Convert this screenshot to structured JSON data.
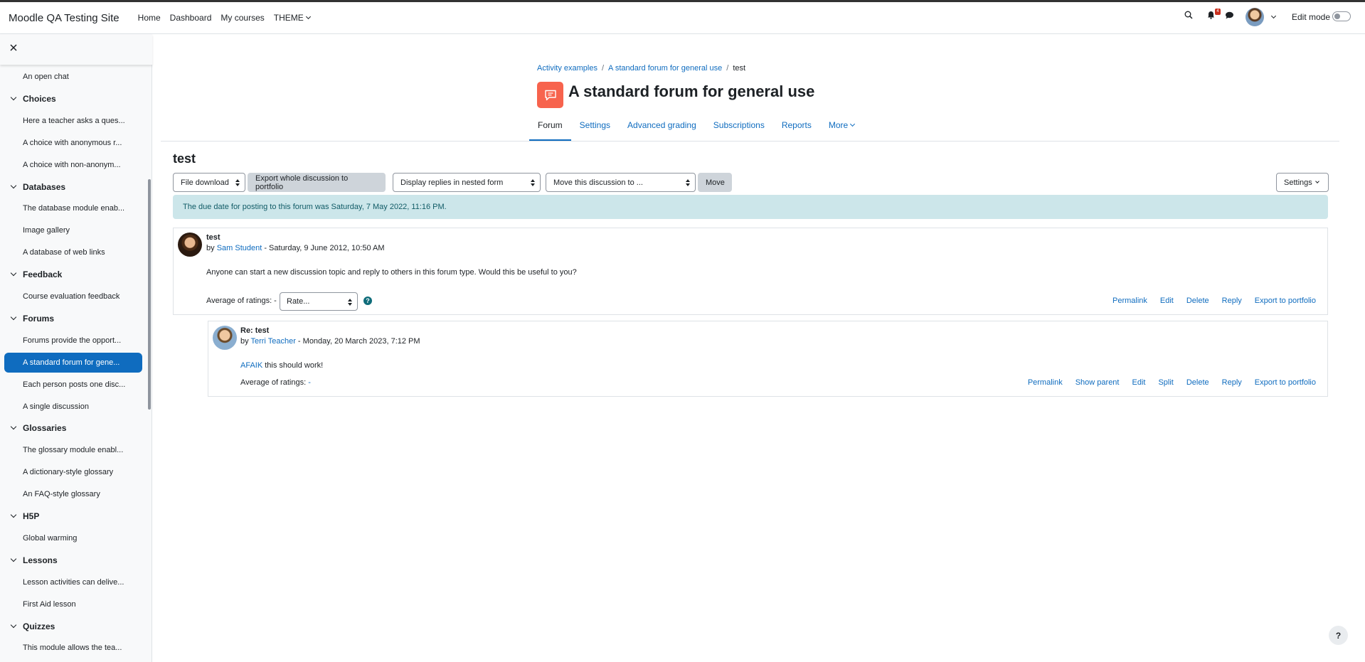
{
  "navbar": {
    "brand": "Moodle QA Testing Site",
    "items": [
      "Home",
      "Dashboard",
      "My courses",
      "THEME"
    ],
    "notification_count": "4",
    "edit_mode_label": "Edit mode"
  },
  "drawer": {
    "close_symbol": "×",
    "entries": [
      {
        "type": "activity",
        "label": "An open chat"
      },
      {
        "type": "category",
        "label": "Choices"
      },
      {
        "type": "activity",
        "label": "Here a teacher asks a ques..."
      },
      {
        "type": "activity",
        "label": "A choice with anonymous r..."
      },
      {
        "type": "activity",
        "label": "A choice with non-anonym..."
      },
      {
        "type": "category",
        "label": "Databases"
      },
      {
        "type": "activity",
        "label": "The database module enab..."
      },
      {
        "type": "activity",
        "label": "Image gallery"
      },
      {
        "type": "activity",
        "label": "A database of web links"
      },
      {
        "type": "category",
        "label": "Feedback"
      },
      {
        "type": "activity",
        "label": "Course evaluation feedback"
      },
      {
        "type": "category",
        "label": "Forums"
      },
      {
        "type": "activity",
        "label": "Forums provide the opport..."
      },
      {
        "type": "activity",
        "label": "A standard forum for gene...",
        "active": true
      },
      {
        "type": "activity",
        "label": "Each person posts one disc..."
      },
      {
        "type": "activity",
        "label": "A single discussion"
      },
      {
        "type": "category",
        "label": "Glossaries"
      },
      {
        "type": "activity",
        "label": "The glossary module enabl..."
      },
      {
        "type": "activity",
        "label": "A dictionary-style glossary"
      },
      {
        "type": "activity",
        "label": "An FAQ-style glossary"
      },
      {
        "type": "category",
        "label": "H5P"
      },
      {
        "type": "activity",
        "label": "Global warming"
      },
      {
        "type": "category",
        "label": "Lessons"
      },
      {
        "type": "activity",
        "label": "Lesson activities can delive..."
      },
      {
        "type": "activity",
        "label": "First Aid lesson"
      },
      {
        "type": "category",
        "label": "Quizzes"
      },
      {
        "type": "activity",
        "label": "This module allows the tea..."
      }
    ]
  },
  "header": {
    "breadcrumb": [
      "Activity examples",
      "A standard forum for general use",
      "test"
    ],
    "title": "A standard forum for general use",
    "tabs": [
      "Forum",
      "Settings",
      "Advanced grading",
      "Subscriptions",
      "Reports",
      "More"
    ],
    "active_tab": "Forum"
  },
  "discussion": {
    "title": "test",
    "file_download": "File download",
    "export_button": "Export whole discussion to portfolio",
    "display_mode": "Display replies in nested form",
    "move_select": "Move this discussion to ...",
    "move_button": "Move",
    "settings_button": "Settings",
    "alert": "The due date for posting to this forum was Saturday, 7 May 2022, 11:16 PM."
  },
  "posts": [
    {
      "subject": "test",
      "by_prefix": "by",
      "author": "Sam Student",
      "date": " - Saturday, 9 June 2012, 10:50 AM",
      "message": "Anyone can start a new discussion topic and reply to others in this forum type. Would this be useful to you?",
      "rating_label": "Average of ratings: -",
      "rate_placeholder": "Rate...",
      "help_symbol": "?",
      "commands": [
        "Permalink",
        "Edit",
        "Delete",
        "Reply",
        "Export to portfolio"
      ]
    },
    {
      "subject": "Re: test",
      "by_prefix": "by",
      "author": "Terri Teacher",
      "date": " - Monday, 20 March 2023, 7:12 PM",
      "message_link": "AFAIK",
      "message_rest": " this should work!",
      "rating_label": "Average of ratings:",
      "rating_value": "-",
      "commands": [
        "Permalink",
        "Show parent",
        "Edit",
        "Split",
        "Delete",
        "Reply",
        "Export to portfolio"
      ]
    }
  ],
  "help_button": "?",
  "colors": {
    "accent": "#0f6cbf",
    "forum_icon": "#f7634d",
    "alert_bg": "#cce6ea",
    "badge": "#ca3120"
  }
}
